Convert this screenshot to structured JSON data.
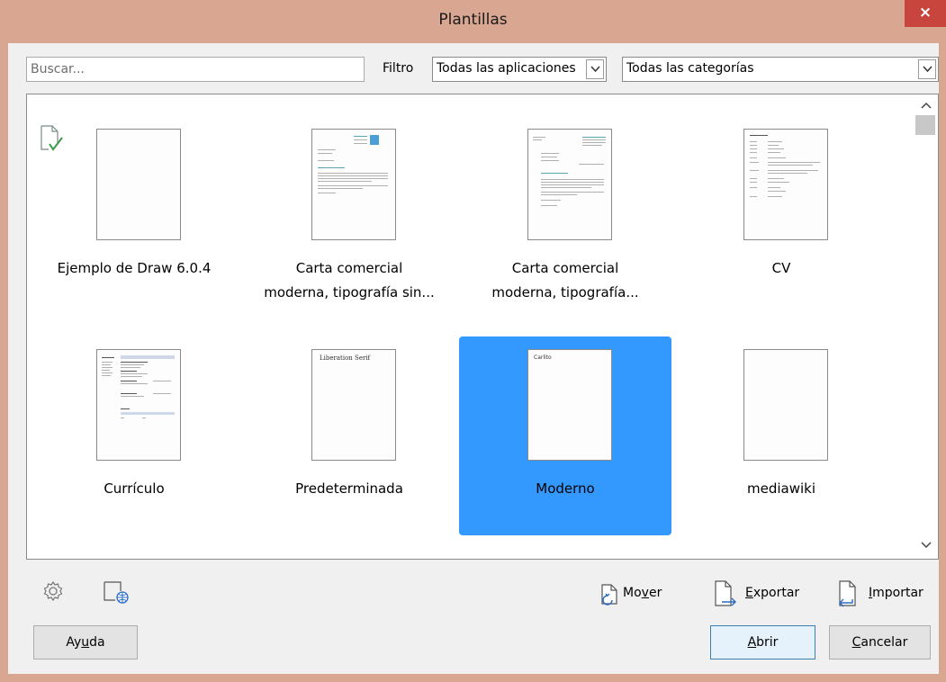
{
  "window": {
    "title": "Plantillas",
    "close_symbol": "×"
  },
  "search": {
    "placeholder": "Buscar...",
    "value": ""
  },
  "filter": {
    "label": "Filtro",
    "application": "Todas las aplicaciones",
    "category": "Todas las categorías"
  },
  "templates": [
    {
      "line1": "Ejemplo de Draw 6.0.4",
      "line2": ""
    },
    {
      "line1": "Carta comercial",
      "line2": "moderna, tipografía sin..."
    },
    {
      "line1": "Carta comercial",
      "line2": "moderna, tipografía..."
    },
    {
      "line1": "CV",
      "line2": ""
    },
    {
      "line1": "Currículo",
      "line2": ""
    },
    {
      "line1": "Predeterminada",
      "line2": "",
      "thumb_text": "Liberation Serif"
    },
    {
      "line1": "Moderno",
      "line2": "",
      "thumb_text": "Carlito",
      "selected": true
    },
    {
      "line1": "mediawiki",
      "line2": ""
    }
  ],
  "actions": {
    "move": {
      "pre": "Mo",
      "key": "v",
      "post": "er"
    },
    "export": {
      "pre": "",
      "key": "E",
      "post": "xportar"
    },
    "import": {
      "pre": "",
      "key": "I",
      "post": "mportar"
    }
  },
  "buttons": {
    "help": {
      "pre": "Ay",
      "key": "u",
      "post": "da"
    },
    "open": {
      "pre": "",
      "key": "A",
      "post": "brir"
    },
    "cancel": {
      "pre": "",
      "key": "C",
      "post": "ancelar"
    }
  },
  "colors": {
    "selection": "#3399ff",
    "titlebar": "#d8a691",
    "close": "#c7453d"
  }
}
